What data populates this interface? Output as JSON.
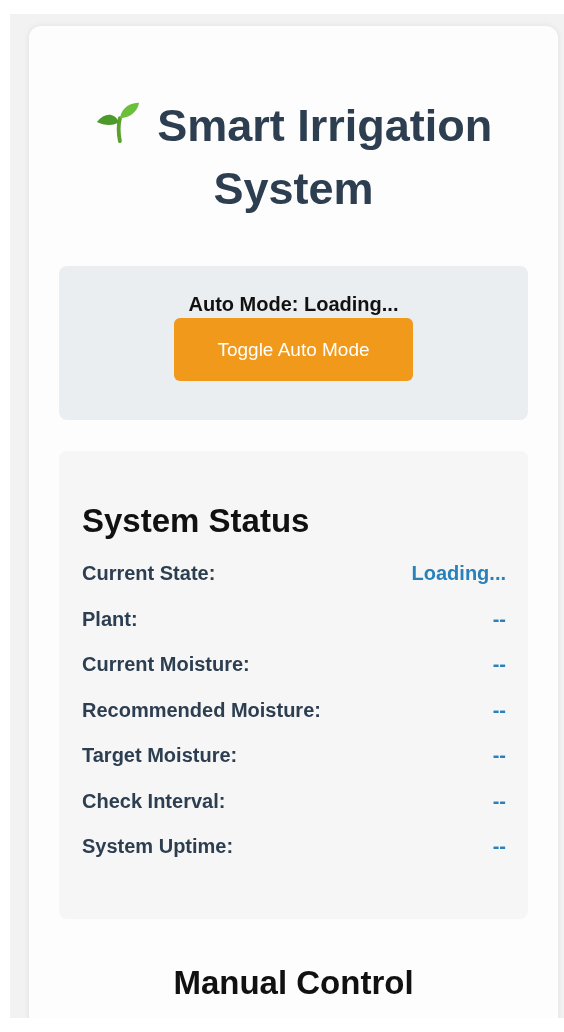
{
  "header": {
    "title": "Smart Irrigation System"
  },
  "auto_mode": {
    "status": "Auto Mode: Loading...",
    "button": "Toggle Auto Mode"
  },
  "status": {
    "title": "System Status",
    "rows": [
      {
        "label": "Current State:",
        "value": "Loading..."
      },
      {
        "label": "Plant:",
        "value": "--"
      },
      {
        "label": "Current Moisture:",
        "value": "--"
      },
      {
        "label": "Recommended Moisture:",
        "value": "--"
      },
      {
        "label": "Target Moisture:",
        "value": "--"
      },
      {
        "label": "Check Interval:",
        "value": "--"
      },
      {
        "label": "System Uptime:",
        "value": "--"
      }
    ]
  },
  "manual": {
    "title": "Manual Control"
  }
}
